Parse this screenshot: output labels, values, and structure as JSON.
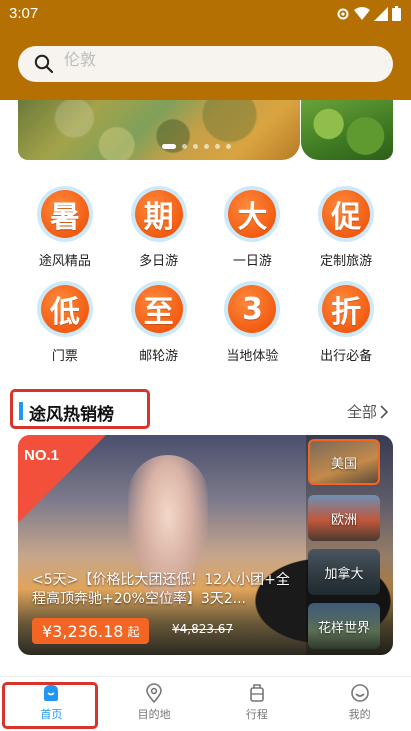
{
  "status_bar": {
    "time": "3:07"
  },
  "search": {
    "placeholder": "伦敦"
  },
  "banner": {
    "dots": 6,
    "active_dot": 0
  },
  "categories": [
    {
      "glyph": "暑",
      "label": "途风精品"
    },
    {
      "glyph": "期",
      "label": "多日游"
    },
    {
      "glyph": "大",
      "label": "一日游"
    },
    {
      "glyph": "促",
      "label": "定制旅游"
    },
    {
      "glyph": "低",
      "label": "门票"
    },
    {
      "glyph": "至",
      "label": "邮轮游"
    },
    {
      "glyph": "3",
      "label": "当地体验"
    },
    {
      "glyph": "折",
      "label": "出行必备"
    }
  ],
  "section": {
    "title": "途风热销榜",
    "more": "全部"
  },
  "featured": {
    "rank": "NO.1",
    "description": "<5天>【价格比大团还低！12人小团+全程高顶奔驰+20%空位率】3天2...",
    "price": "¥3,236.18",
    "price_suffix": "起",
    "original_price": "¥4,823.67"
  },
  "regions": [
    {
      "label": "美国",
      "selected": true
    },
    {
      "label": "欧洲",
      "selected": false
    },
    {
      "label": "加拿大",
      "selected": false
    },
    {
      "label": "花样世界",
      "selected": false
    }
  ],
  "nav": [
    {
      "label": "首页",
      "icon": "home-icon",
      "active": true
    },
    {
      "label": "目的地",
      "icon": "location-pin-icon",
      "active": false
    },
    {
      "label": "行程",
      "icon": "luggage-icon",
      "active": false
    },
    {
      "label": "我的",
      "icon": "profile-icon",
      "active": false
    }
  ],
  "colors": {
    "header": "#B57004",
    "accent": "#F26522",
    "nav_active": "#2196F3"
  }
}
